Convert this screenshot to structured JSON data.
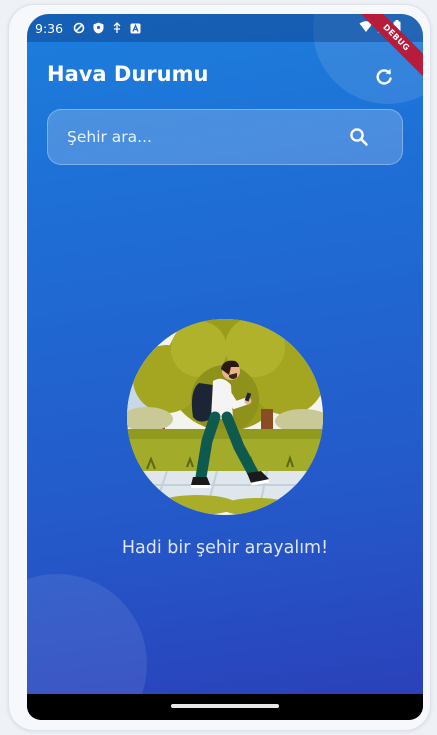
{
  "status_bar": {
    "time": "9:36",
    "left_icons": [
      "shield-outline-icon",
      "shield-filled-icon",
      "usb-icon",
      "notification-a-icon"
    ],
    "right_icons": [
      "wifi-icon",
      "signal-icon",
      "battery-icon"
    ]
  },
  "debug_banner": "DEBUG",
  "app": {
    "title": "Hava Durumu",
    "refresh_icon": "refresh-icon"
  },
  "search": {
    "placeholder": "Şehir ara...",
    "value": "",
    "icon": "search-icon"
  },
  "empty_state": {
    "illustration": "person-walking-illustration",
    "message": "Hadi bir şehir arayalım!"
  },
  "colors": {
    "gradient_top": "#1c7fdc",
    "gradient_bottom": "#2b3eb8",
    "text": "#ffffff"
  }
}
